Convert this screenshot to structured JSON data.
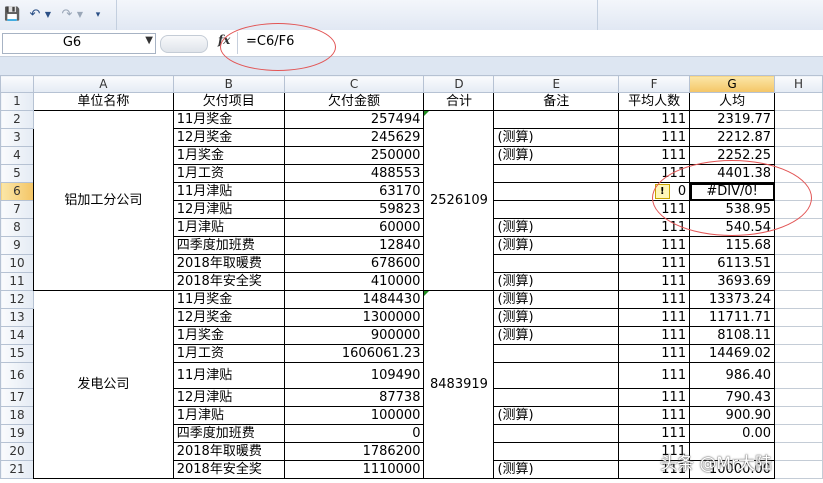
{
  "name_box": "G6",
  "formula_bar": {
    "fx_label": "fx",
    "formula": "=C6/F6"
  },
  "columns": [
    "A",
    "B",
    "C",
    "D",
    "E",
    "F",
    "G",
    "H"
  ],
  "headers": [
    "单位名称",
    "欠付项目",
    "欠付金额",
    "合计",
    "备注",
    "平均人数",
    "人均"
  ],
  "groups": [
    {
      "unit": "铝加工分公司",
      "total": "2526109"
    },
    {
      "unit": "发电公司",
      "total": "8483919"
    }
  ],
  "rows": [
    {
      "num": "2",
      "item": "11月奖金",
      "amount": "257494",
      "note": "",
      "people": "111",
      "avg": "2319.77"
    },
    {
      "num": "3",
      "item": "12月奖金",
      "amount": "245629",
      "note": "(测算)",
      "people": "111",
      "avg": "2212.87"
    },
    {
      "num": "4",
      "item": "1月奖金",
      "amount": "250000",
      "note": "(测算)",
      "people": "111",
      "avg": "2252.25"
    },
    {
      "num": "5",
      "item": "1月工资",
      "amount": "488553",
      "note": "",
      "people": "111",
      "avg": "4401.38"
    },
    {
      "num": "6",
      "item": "11月津贴",
      "amount": "63170",
      "note": "",
      "people": "0",
      "avg": "#DIV/0!"
    },
    {
      "num": "7",
      "item": "12月津贴",
      "amount": "59823",
      "note": "",
      "people": "111",
      "avg": "538.95"
    },
    {
      "num": "8",
      "item": "1月津贴",
      "amount": "60000",
      "note": "(测算)",
      "people": "111",
      "avg": "540.54"
    },
    {
      "num": "9",
      "item": "四季度加班费",
      "amount": "12840",
      "note": "(测算)",
      "people": "111",
      "avg": "115.68"
    },
    {
      "num": "10",
      "item": "2018年取暖费",
      "amount": "678600",
      "note": "",
      "people": "111",
      "avg": "6113.51"
    },
    {
      "num": "11",
      "item": "2018年安全奖",
      "amount": "410000",
      "note": "(测算)",
      "people": "111",
      "avg": "3693.69"
    },
    {
      "num": "12",
      "item": "11月奖金",
      "amount": "1484430",
      "note": "(测算)",
      "people": "111",
      "avg": "13373.24"
    },
    {
      "num": "13",
      "item": "12月奖金",
      "amount": "1300000",
      "note": "(测算)",
      "people": "111",
      "avg": "11711.71"
    },
    {
      "num": "14",
      "item": "1月奖金",
      "amount": "900000",
      "note": "(测算)",
      "people": "111",
      "avg": "8108.11"
    },
    {
      "num": "15",
      "item": "1月工资",
      "amount": "1606061.23",
      "note": "",
      "people": "111",
      "avg": "14469.02"
    },
    {
      "num": "16",
      "item": "11月津贴",
      "amount": "109490",
      "note": "",
      "people": "111",
      "avg": "986.40"
    },
    {
      "num": "17",
      "item": "12月津贴",
      "amount": "87738",
      "note": "",
      "people": "111",
      "avg": "790.43"
    },
    {
      "num": "18",
      "item": "1月津贴",
      "amount": "100000",
      "note": "(测算)",
      "people": "111",
      "avg": "900.90"
    },
    {
      "num": "19",
      "item": "四季度加班费",
      "amount": "0",
      "note": "",
      "people": "111",
      "avg": "0.00"
    },
    {
      "num": "20",
      "item": "2018年取暖费",
      "amount": "1786200",
      "note": "",
      "people": "111",
      "avg": ""
    },
    {
      "num": "21",
      "item": "2018年安全奖",
      "amount": "1110000",
      "note": "(测算)",
      "people": "111",
      "avg": "10000.00"
    }
  ],
  "watermark": "头条 @Mr大陆",
  "colors": {
    "annotation_oval": "#e25555",
    "error_triangle": "#1e8b1e",
    "selected_header": "#f4c566"
  }
}
